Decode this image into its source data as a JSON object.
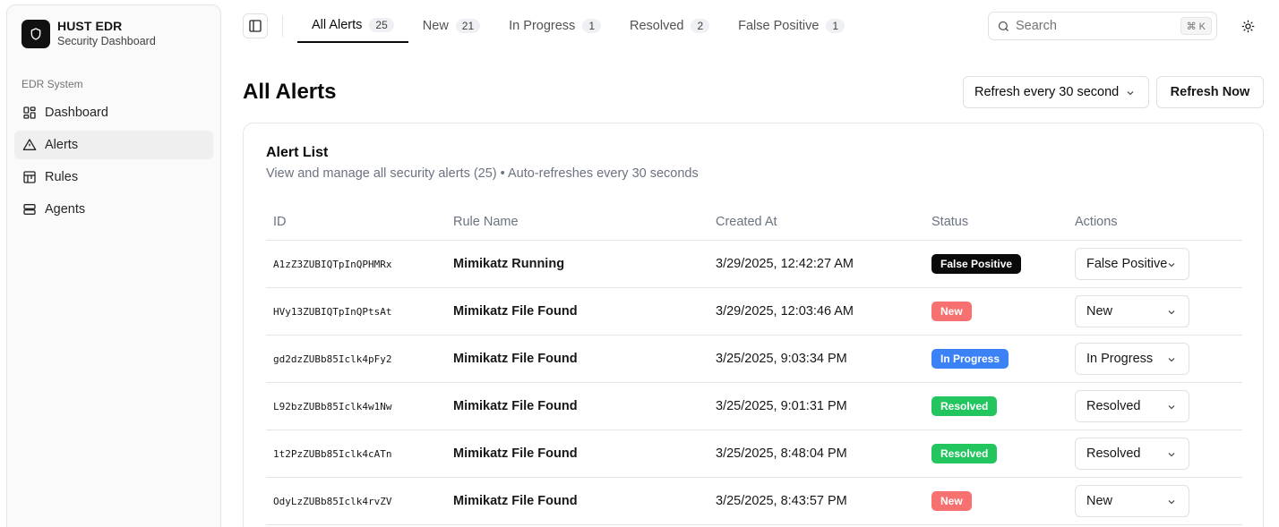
{
  "brand": {
    "title": "HUST EDR",
    "subtitle": "Security Dashboard"
  },
  "sidebar": {
    "group_label": "EDR System",
    "items": [
      {
        "label": "Dashboard",
        "icon": "dashboard-icon"
      },
      {
        "label": "Alerts",
        "icon": "alert-triangle-icon",
        "active": true
      },
      {
        "label": "Rules",
        "icon": "rules-icon"
      },
      {
        "label": "Agents",
        "icon": "server-icon"
      }
    ]
  },
  "tabs": [
    {
      "label": "All Alerts",
      "count": "25",
      "active": true
    },
    {
      "label": "New",
      "count": "21"
    },
    {
      "label": "In Progress",
      "count": "1"
    },
    {
      "label": "Resolved",
      "count": "2"
    },
    {
      "label": "False Positive",
      "count": "1"
    }
  ],
  "search": {
    "placeholder": "Search",
    "shortcut": "⌘ K"
  },
  "page": {
    "title": "All Alerts",
    "refresh_select": "Refresh every 30 second",
    "refresh_now": "Refresh Now"
  },
  "card": {
    "title": "Alert List",
    "description": "View and manage all security alerts (25) • Auto-refreshes every 30 seconds"
  },
  "table": {
    "headers": [
      "ID",
      "Rule Name",
      "Created At",
      "Status",
      "Actions"
    ],
    "rows": [
      {
        "id": "A1zZ3ZUBIQTpInQPHMRx",
        "rule": "Mimikatz Running",
        "created": "3/29/2025, 12:42:27 AM",
        "status": "False Positive",
        "action": "False Positive"
      },
      {
        "id": "HVy13ZUBIQTpInQPtsAt",
        "rule": "Mimikatz File Found",
        "created": "3/29/2025, 12:03:46 AM",
        "status": "New",
        "action": "New"
      },
      {
        "id": "gd2dzZUBb85Iclk4pFy2",
        "rule": "Mimikatz File Found",
        "created": "3/25/2025, 9:03:34 PM",
        "status": "In Progress",
        "action": "In Progress"
      },
      {
        "id": "L92bzZUBb85Iclk4w1Nw",
        "rule": "Mimikatz File Found",
        "created": "3/25/2025, 9:01:31 PM",
        "status": "Resolved",
        "action": "Resolved"
      },
      {
        "id": "1t2PzZUBb85Iclk4cATn",
        "rule": "Mimikatz File Found",
        "created": "3/25/2025, 8:48:04 PM",
        "status": "Resolved",
        "action": "Resolved"
      },
      {
        "id": "OdyLzZUBb85Iclk4rvZV",
        "rule": "Mimikatz File Found",
        "created": "3/25/2025, 8:43:57 PM",
        "status": "New",
        "action": "New"
      }
    ]
  },
  "status_colors": {
    "False Positive": "#0a0a0a",
    "New": "#f87171",
    "In Progress": "#3b82f6",
    "Resolved": "#22c55e"
  }
}
